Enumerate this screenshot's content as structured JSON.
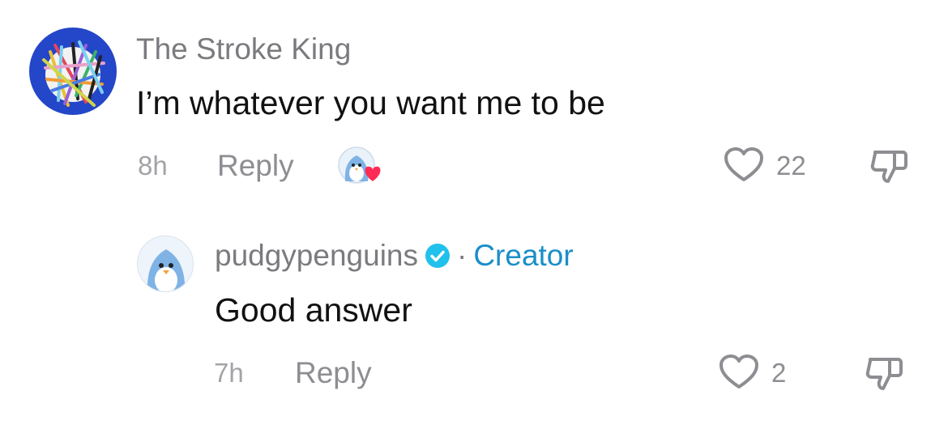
{
  "comments": [
    {
      "username": "The Stroke King",
      "text": "I’m whatever you want me to be",
      "time": "8h",
      "reply_label": "Reply",
      "likes": "22",
      "avatar_icon": "scribble-art-avatar",
      "creator_liked_icon": "penguin-heart-icon"
    },
    {
      "username": "pudgypenguins",
      "verified": true,
      "badge_separator": "·",
      "badge": "Creator",
      "text": "Good answer",
      "time": "7h",
      "reply_label": "Reply",
      "likes": "2",
      "avatar_icon": "penguin-avatar"
    }
  ],
  "colors": {
    "creator_blue": "#1a8ec9",
    "verified_blue": "#20c1ec",
    "heart_red": "#fe2c55",
    "muted_text": "#8d8d92"
  }
}
